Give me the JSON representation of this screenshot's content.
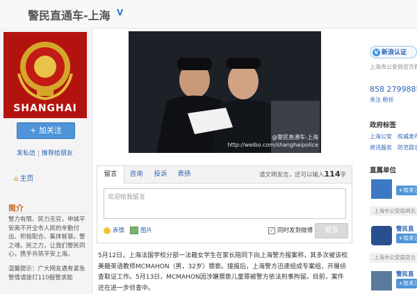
{
  "header": {
    "title": "警民直通车-上海",
    "verified_icon": "verified-v-icon"
  },
  "profile": {
    "avatar_text": "SHANGHAI",
    "follow_label": "+ 加关注",
    "send_dm": "发私信",
    "separator": "|",
    "recommend": "推荐给朋友",
    "home": "主页"
  },
  "intro": {
    "heading": "简介",
    "text": "警力有限、民力无穷，申城平安离不开全市人民的辛勤付出、积极配合、集体智慧。警之魂，民之力，让我们警民同心，携手共筑平安上海。",
    "tip": "温馨提示：广大网友遇有紧急警情请拨打110报警求助"
  },
  "photo": {
    "watermark_name": "@警民直通车-上海",
    "watermark_url": "http://weibo.com/shanghaipolice"
  },
  "message_box": {
    "tabs": [
      "留言",
      "咨询",
      "投诉",
      "表扬"
    ],
    "counter_prefix": "请文明发言，还可以输入",
    "counter_value": "114",
    "counter_suffix": "字",
    "placeholder": "欢迎给我留言",
    "emoji_label": "表情",
    "image_label": "图片",
    "sync_label": "同时发到微博",
    "submit_label": "留言"
  },
  "post": {
    "text": "5月12日，上海法国学校分部一法籍女学生在家长陪同下向上海警方报案称，其多次被该校美籍英语教师MCMAHON（男，32岁）猥亵。接报后，上海警方迅速组成专案组，开展侦查取证工作。5月13日，MCMAHON因涉嫌猥亵儿童罪被警方依法刑事拘留。目前，案件还在进一步侦查中。"
  },
  "right": {
    "verify_label": "新浪认证",
    "verify_desc": "上海市公安局官方微",
    "stats_numbers": "858  2799885",
    "stats_labels": "关注     粉丝",
    "tags_heading": "政府标签",
    "tags": [
      "上海公安",
      "权威发布",
      "资讯服务",
      "防范提示"
    ],
    "units_heading": "直属单位",
    "units": [
      {
        "name": "",
        "add": "+加关注",
        "sub": "上海市公安局闸北"
      },
      {
        "name": "警民直",
        "add": "+加关注",
        "sub": "上海市公安局官方"
      },
      {
        "name": "警民直",
        "add": "+加关注",
        "sub": ""
      }
    ]
  }
}
